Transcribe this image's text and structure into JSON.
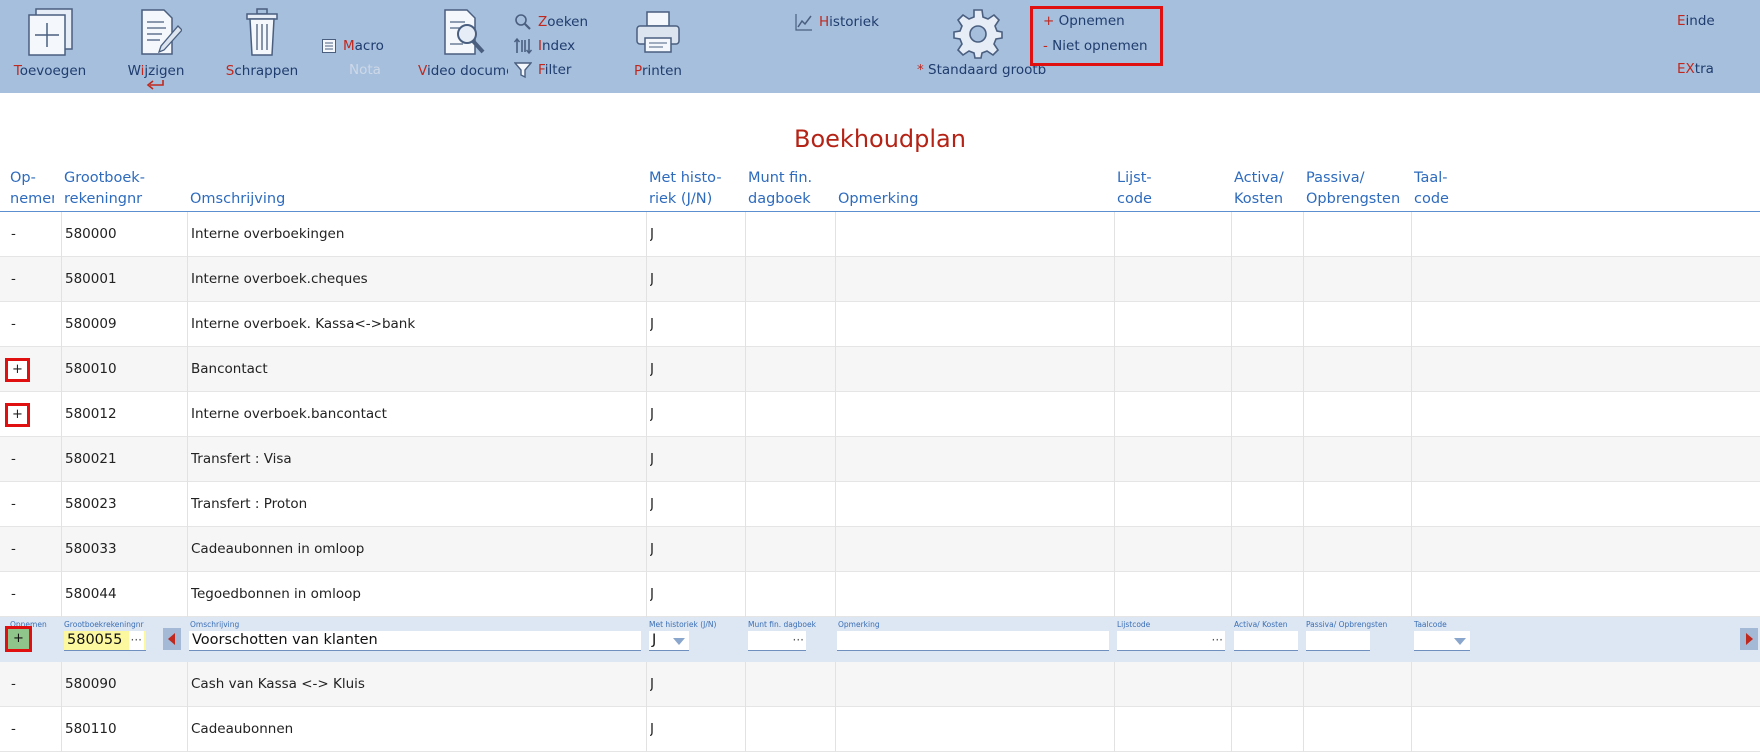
{
  "toolbar": {
    "toevoegen": {
      "first": "T",
      "rest": "oevoegen"
    },
    "wijzigen": {
      "pre": "W",
      "acc": "i",
      "post": "jzigen"
    },
    "schrappen": {
      "first": "S",
      "rest": "chrappen"
    },
    "macro": {
      "first": "M",
      "rest": "acro"
    },
    "nota": "Nota",
    "video": {
      "first": "V",
      "rest": "ideo docume"
    },
    "zoeken": {
      "first": "Z",
      "rest": "oeken"
    },
    "index": {
      "first": "I",
      "rest": "ndex"
    },
    "filter": {
      "first": "F",
      "rest": "ilter"
    },
    "printen": {
      "first": "P",
      "rest": "rinten"
    },
    "historiek": {
      "first": "H",
      "rest": "istoriek"
    },
    "standaard": {
      "star": "*",
      "label": "Standaard grootb"
    },
    "opnemen": {
      "sign": "+",
      "label": "Opnemen"
    },
    "niet_opnemen": {
      "sign": "-",
      "label": "Niet opnemen"
    },
    "einde": {
      "first": "E",
      "rest": "inde"
    },
    "extra": {
      "first": "EX",
      "rest": "tra"
    }
  },
  "title": "Boekhoudplan",
  "columns": {
    "opnemen": [
      "Op-",
      "nemen"
    ],
    "rekeningnr": [
      "Grootboek-",
      "rekeningnr"
    ],
    "omschrijving": "Omschrijving",
    "historiek": [
      "Met histo-",
      "riek (J/N)"
    ],
    "munt": [
      "Munt fin.",
      "dagboek"
    ],
    "opmerking": "Opmerking",
    "lijstcode": [
      "Lijst-",
      "code"
    ],
    "activa": [
      "Activa/",
      "Kosten"
    ],
    "passiva": [
      "Passiva/",
      "Opbrengsten"
    ],
    "taalcode": [
      "Taal-",
      "code"
    ]
  },
  "rows": [
    {
      "opnemen": "-",
      "nr": "580000",
      "omschrijving": "Interne overboekingen",
      "historiek": "J"
    },
    {
      "opnemen": "-",
      "nr": "580001",
      "omschrijving": "Interne overboek.cheques",
      "historiek": "J"
    },
    {
      "opnemen": "-",
      "nr": "580009",
      "omschrijving": "Interne overboek. Kassa<->bank",
      "historiek": "J"
    },
    {
      "opnemen": "+",
      "nr": "580010",
      "omschrijving": "Bancontact",
      "historiek": "J"
    },
    {
      "opnemen": "+",
      "nr": "580012",
      "omschrijving": "Interne overboek.bancontact",
      "historiek": "J"
    },
    {
      "opnemen": "-",
      "nr": "580021",
      "omschrijving": "Transfert : Visa",
      "historiek": "J"
    },
    {
      "opnemen": "-",
      "nr": "580023",
      "omschrijving": "Transfert : Proton",
      "historiek": "J"
    },
    {
      "opnemen": "-",
      "nr": "580033",
      "omschrijving": "Cadeaubonnen in omloop",
      "historiek": "J"
    },
    {
      "opnemen": "-",
      "nr": "580044",
      "omschrijving": "Tegoedbonnen in omloop",
      "historiek": "J"
    },
    {
      "opnemen": "-",
      "nr": "580090",
      "omschrijving": "Cash van Kassa <-> Kluis",
      "historiek": "J"
    },
    {
      "opnemen": "-",
      "nr": "580110",
      "omschrijving": "Cadeaubonnen",
      "historiek": "J"
    }
  ],
  "edit_row": {
    "labels": {
      "opnemen": "Opnemen",
      "rekeningnr": "Grootboekrekeningnr",
      "omschrijving": "Omschrijving",
      "historiek": "Met historiek (J/N)",
      "munt": "Munt fin. dagboek",
      "opmerking": "Opmerking",
      "lijstcode": "Lijstcode",
      "activa": "Activa/ Kosten",
      "passiva": "Passiva/ Opbrengsten",
      "taalcode": "Taalcode"
    },
    "opnemen": "+",
    "rekeningnr": "580055",
    "omschrijving": "Voorschotten van klanten",
    "historiek": "J",
    "munt": "",
    "opmerking": "",
    "lijstcode": "",
    "activa": "",
    "passiva": "",
    "taalcode": "",
    "ellipsis": "···"
  },
  "colors": {
    "toolbar_bg": "#a6bfdc",
    "accent_red": "#c0281e",
    "header_blue": "#2e6bbd",
    "highlight_box": "#e01010"
  }
}
